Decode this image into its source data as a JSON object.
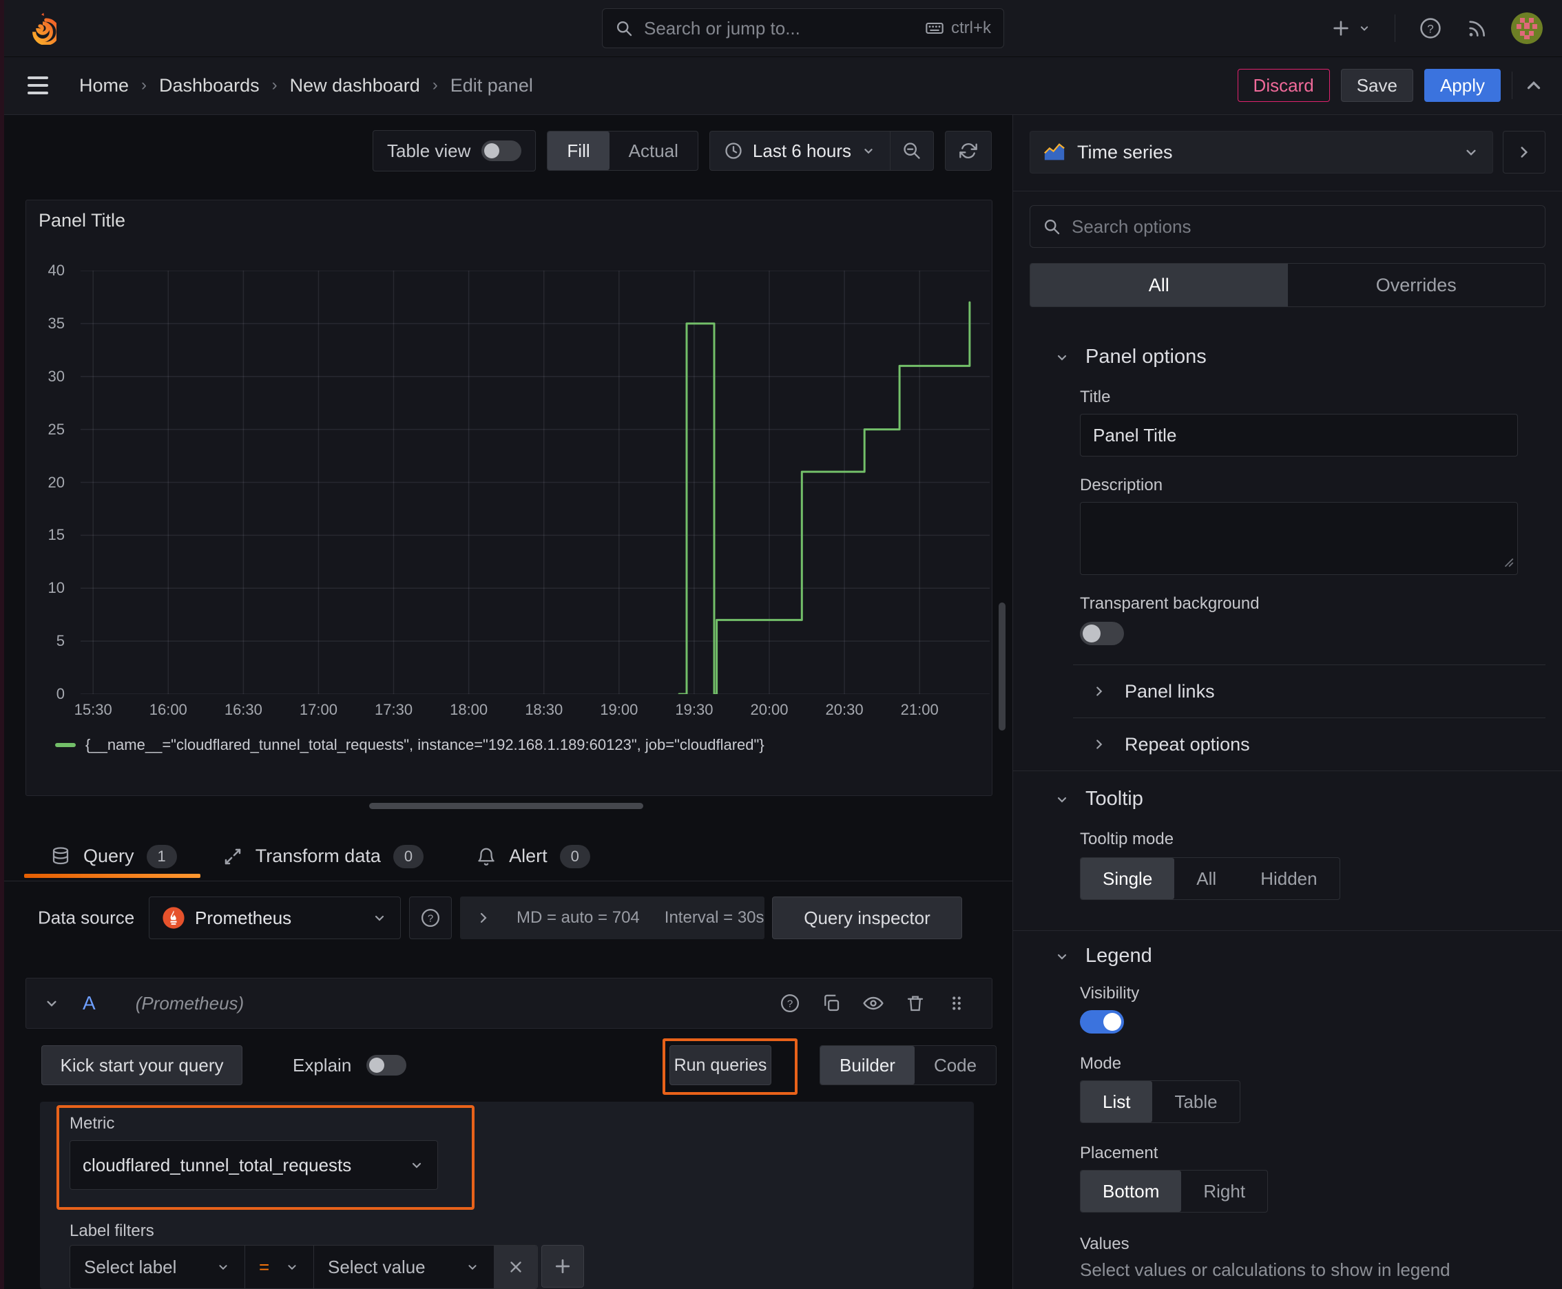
{
  "topnav": {
    "search_placeholder": "Search or jump to...",
    "search_shortcut": "ctrl+k"
  },
  "breadcrumb": {
    "items": [
      "Home",
      "Dashboards",
      "New dashboard"
    ],
    "current": "Edit panel"
  },
  "actions": {
    "discard": "Discard",
    "save": "Save",
    "apply": "Apply"
  },
  "panel_toolbar": {
    "table_view": "Table view",
    "fill": "Fill",
    "actual": "Actual",
    "time_range": "Last 6 hours"
  },
  "panel": {
    "title": "Panel Title"
  },
  "chart_data": {
    "type": "line",
    "title": "Panel Title",
    "step": true,
    "grid": true,
    "legend_position": "bottom",
    "x_domain": [
      "15:25",
      "21:28"
    ],
    "y_domain": [
      0,
      40
    ],
    "x_ticks": [
      "15:30",
      "16:00",
      "16:30",
      "17:00",
      "17:30",
      "18:00",
      "18:30",
      "19:00",
      "19:30",
      "20:00",
      "20:30",
      "21:00"
    ],
    "y_ticks": [
      0,
      5,
      10,
      15,
      20,
      25,
      30,
      35,
      40
    ],
    "series": [
      {
        "name": "{__name__=\"cloudflared_tunnel_total_requests\", instance=\"192.168.1.189:60123\", job=\"cloudflared\"}",
        "color": "#73bf69",
        "points": [
          {
            "t": "19:24",
            "v": 0
          },
          {
            "t": "19:27",
            "v": 35
          },
          {
            "t": "19:38",
            "v": 0
          },
          {
            "t": "19:39",
            "v": 7
          },
          {
            "t": "20:13",
            "v": 21
          },
          {
            "t": "20:38",
            "v": 25
          },
          {
            "t": "20:52",
            "v": 31
          },
          {
            "t": "21:20",
            "v": 37
          }
        ]
      }
    ]
  },
  "tabs": {
    "query": "Query",
    "query_count": "1",
    "transform": "Transform data",
    "transform_count": "0",
    "alert": "Alert",
    "alert_count": "0"
  },
  "datasource": {
    "label": "Data source",
    "name": "Prometheus",
    "stat_md": "MD = auto = 704",
    "stat_interval": "Interval = 30s",
    "inspector": "Query inspector"
  },
  "query_editor": {
    "ref_id": "A",
    "ds_hint": "(Prometheus)",
    "kickstart": "Kick start your query",
    "explain": "Explain",
    "run": "Run queries",
    "builder": "Builder",
    "code": "Code",
    "metric_label": "Metric",
    "metric_value": "cloudflared_tunnel_total_requests",
    "label_filters": "Label filters",
    "select_label": "Select label",
    "operator": "=",
    "select_value": "Select value"
  },
  "options": {
    "viz": "Time series",
    "search_placeholder": "Search options",
    "tab_all": "All",
    "tab_overrides": "Overrides",
    "panel_options": {
      "heading": "Panel options",
      "title_label": "Title",
      "title_value": "Panel Title",
      "description_label": "Description",
      "transparent": "Transparent background",
      "links": "Panel links",
      "repeat": "Repeat options"
    },
    "tooltip": {
      "heading": "Tooltip",
      "mode_label": "Tooltip mode",
      "modes": [
        "Single",
        "All",
        "Hidden"
      ],
      "selected": "Single"
    },
    "legend": {
      "heading": "Legend",
      "visibility": "Visibility",
      "mode_label": "Mode",
      "modes": [
        "List",
        "Table"
      ],
      "selected_mode": "List",
      "placement_label": "Placement",
      "placements": [
        "Bottom",
        "Right"
      ],
      "selected_placement": "Bottom",
      "values_label": "Values",
      "values_hint": "Select values or calculations to show in legend"
    }
  },
  "colors": {
    "accent_orange": "#ff780a",
    "highlight_orange": "#e8621a",
    "accent_blue": "#3b73de",
    "series_green": "#73bf69",
    "danger_pink": "#e0226e"
  }
}
